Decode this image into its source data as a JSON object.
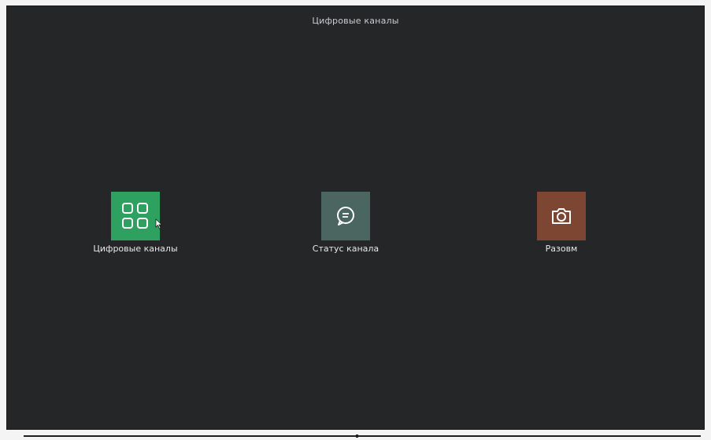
{
  "window": {
    "title": "Цифровые каналы"
  },
  "tiles": [
    {
      "label": "Цифровые каналы",
      "icon": "grid-icon",
      "color": "#2ea05f"
    },
    {
      "label": "Статус канала",
      "icon": "chat-status-icon",
      "color": "#4b6560"
    },
    {
      "label": "Разовм",
      "icon": "camera-icon",
      "color": "#7d4632"
    }
  ],
  "colors": {
    "background": "#252628",
    "text": "#e8e8e8"
  }
}
